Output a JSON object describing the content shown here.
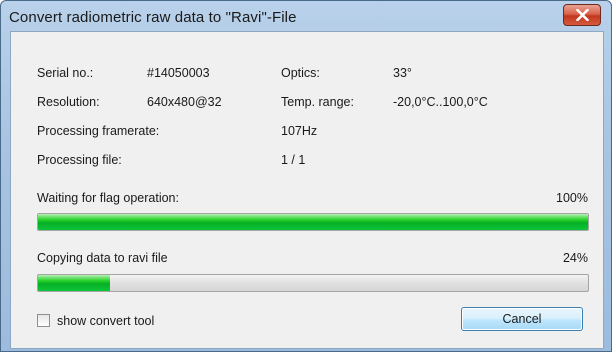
{
  "window": {
    "title": "Convert radiometric raw data to \"Ravi\"-File"
  },
  "info": {
    "serial_label": "Serial no.:",
    "serial_value": "#14050003",
    "optics_label": "Optics:",
    "optics_value": "33°",
    "resolution_label": "Resolution:",
    "resolution_value": "640x480@32",
    "temp_label": "Temp. range:",
    "temp_value": "-20,0°C..100,0°C",
    "framerate_label": "Processing framerate:",
    "framerate_value": "107Hz",
    "file_label": "Processing file:",
    "file_value": "1 / 1"
  },
  "progress": [
    {
      "label": "Waiting for flag operation:",
      "percent_text": "100%",
      "value": 1.0
    },
    {
      "label": "Copying data to ravi file",
      "percent_text": "24%",
      "value": 0.13
    }
  ],
  "controls": {
    "checkbox_label": "show convert tool",
    "checkbox_checked": false,
    "cancel_label": "Cancel"
  },
  "colors": {
    "progress_fill": "#06b025",
    "title_bar": "#a9c4e2",
    "close_button": "#c2381f"
  }
}
